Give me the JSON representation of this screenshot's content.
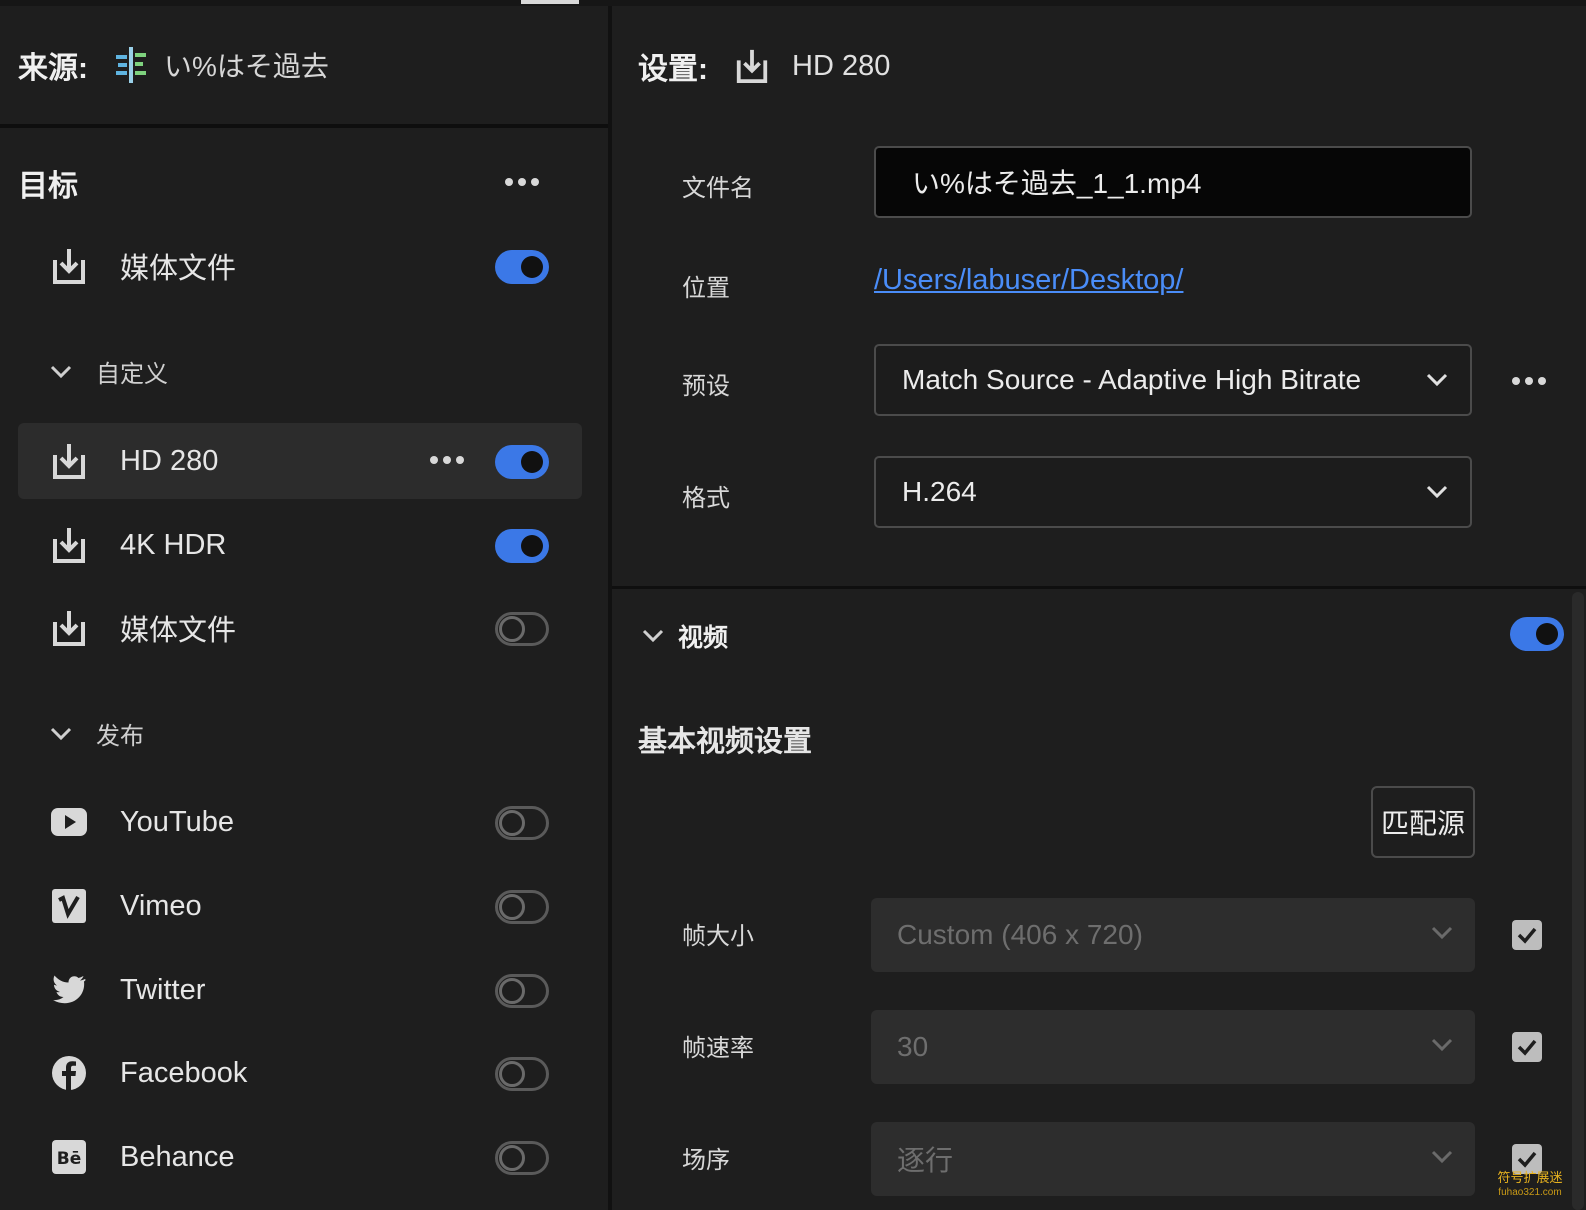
{
  "source": {
    "label": "来源:",
    "name": "い%はそ過去"
  },
  "targets": {
    "title": "目标",
    "media_file": {
      "label": "媒体文件",
      "enabled": true
    },
    "custom_section": "自定义",
    "custom_items": [
      {
        "label": "HD 280",
        "enabled": true,
        "selected": true
      },
      {
        "label": "4K HDR",
        "enabled": true
      },
      {
        "label": "媒体文件",
        "enabled": false
      }
    ],
    "publish_section": "发布",
    "publish_items": [
      {
        "label": "YouTube",
        "enabled": false,
        "icon": "youtube-icon"
      },
      {
        "label": "Vimeo",
        "enabled": false,
        "icon": "vimeo-icon"
      },
      {
        "label": "Twitter",
        "enabled": false,
        "icon": "twitter-icon"
      },
      {
        "label": "Facebook",
        "enabled": false,
        "icon": "facebook-icon"
      },
      {
        "label": "Behance",
        "enabled": false,
        "icon": "behance-icon"
      }
    ]
  },
  "settings": {
    "label": "设置:",
    "name": "HD 280",
    "filename_label": "文件名",
    "filename_value": "い%はそ過去_1_1.mp4",
    "location_label": "位置",
    "location_value": "/Users/labuser/Desktop/",
    "preset_label": "预设",
    "preset_value": "Match Source - Adaptive High Bitrate",
    "format_label": "格式",
    "format_value": "H.264"
  },
  "video": {
    "title": "视频",
    "enabled": true,
    "basic_title": "基本视频设置",
    "match_button": "匹配源",
    "frame_size_label": "帧大小",
    "frame_size_value": "Custom (406 x 720)",
    "frame_rate_label": "帧速率",
    "frame_rate_value": "30",
    "field_order_label": "场序",
    "field_order_value": "逐行"
  },
  "watermark": {
    "line1": "符号扩展迷",
    "line2": "fuhao321.com"
  },
  "colors": {
    "accent": "#3b78e7",
    "link": "#4a8df8",
    "background": "#1e1e1e"
  }
}
